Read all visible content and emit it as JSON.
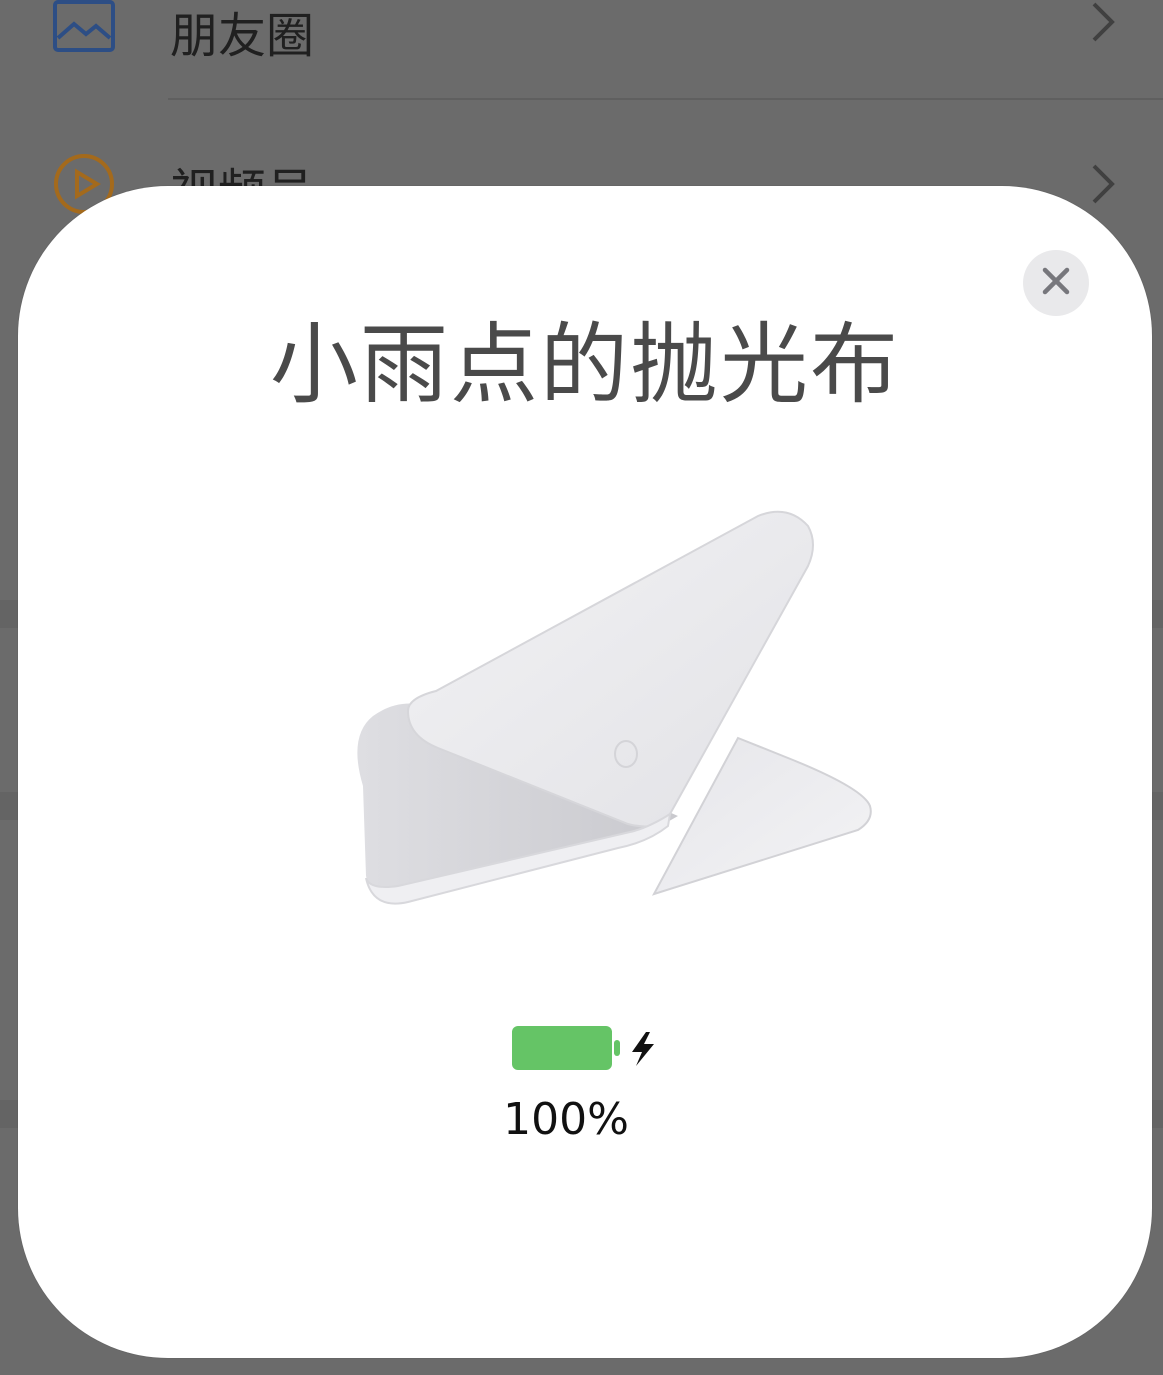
{
  "background": {
    "rows": [
      {
        "label": "朋友圈",
        "icon": "moments-icon"
      },
      {
        "label": "视频号",
        "icon": "channels-icon"
      }
    ]
  },
  "modal": {
    "title": "小雨点的抛光布",
    "close_icon": "close-icon",
    "product_image": "polishing-cloth-image",
    "battery": {
      "level_percent": 100,
      "text": "100%",
      "charging": true,
      "color": "#65c466"
    }
  }
}
